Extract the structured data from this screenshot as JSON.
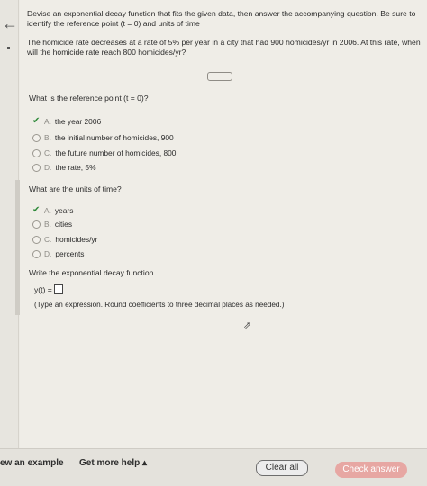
{
  "instructions": "Devise an exponential decay function that fits the given data, then answer the accompanying question. Be sure to identify the reference point (t = 0) and units of time",
  "problem": "The homicide rate decreases at a rate of 5% per year in a city that had 900 homicides/yr in 2006. At this rate, when will the homicide rate reach 800 homicides/yr?",
  "more_label": "....",
  "q1": {
    "title": "What is the reference point (t = 0)?",
    "options": [
      {
        "letter": "A.",
        "text": "the year 2006",
        "selected": true
      },
      {
        "letter": "B.",
        "text": "the initial number of homicides, 900",
        "selected": false
      },
      {
        "letter": "C.",
        "text": "the future number of homicides, 800",
        "selected": false
      },
      {
        "letter": "D.",
        "text": "the rate, 5%",
        "selected": false
      }
    ]
  },
  "q2": {
    "title": "What are the units of time?",
    "options": [
      {
        "letter": "A.",
        "text": "years",
        "selected": true
      },
      {
        "letter": "B.",
        "text": "cities",
        "selected": false
      },
      {
        "letter": "C.",
        "text": "homicides/yr",
        "selected": false
      },
      {
        "letter": "D.",
        "text": "percents",
        "selected": false
      }
    ]
  },
  "q3": {
    "title": "Write the exponential decay function.",
    "answer_label": "y(t) =",
    "hint": "(Type an expression. Round coefficients to three decimal places as needed.)"
  },
  "footer": {
    "view_example": "ew an example",
    "get_help": "Get more help",
    "clear_all": "Clear all",
    "check_answer": "Check answer"
  },
  "colors": {
    "check": "#2f8a3a",
    "check_answer_bg": "#e7a7a3"
  }
}
